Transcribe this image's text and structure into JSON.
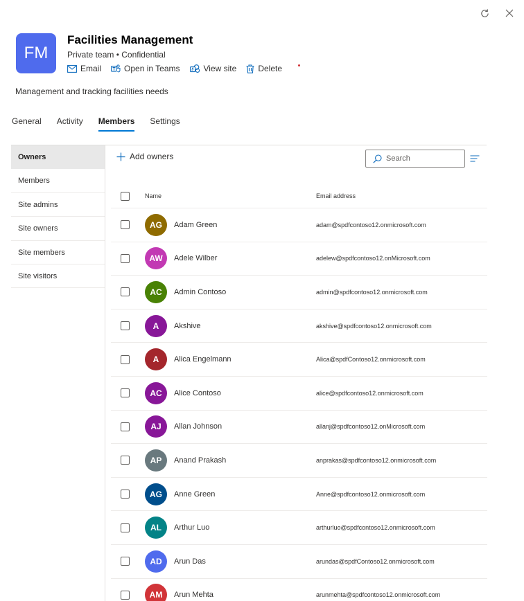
{
  "team": {
    "initials": "FM",
    "name": "Facilities Management",
    "subtitle": "Private team • Confidential",
    "logo_color": "#4f6bed",
    "description": "Management and tracking facilities needs",
    "actions": [
      {
        "label": "Email",
        "icon": "mail-icon"
      },
      {
        "label": "Open in Teams",
        "icon": "teams-icon"
      },
      {
        "label": "View site",
        "icon": "sharepoint-icon"
      },
      {
        "label": "Delete",
        "icon": "trash-icon"
      }
    ]
  },
  "window_actions": [
    {
      "icon": "refresh-icon"
    },
    {
      "icon": "close-icon"
    }
  ],
  "tabs": [
    {
      "label": "General"
    },
    {
      "label": "Activity"
    },
    {
      "label": "Members",
      "active": true
    },
    {
      "label": "Settings"
    }
  ],
  "sidebar": {
    "items": [
      {
        "label": "Owners",
        "active": true
      },
      {
        "label": "Members"
      },
      {
        "label": "Site admins"
      },
      {
        "label": "Site owners"
      },
      {
        "label": "Site members"
      },
      {
        "label": "Site visitors"
      }
    ]
  },
  "toolbar": {
    "add_label": "Add owners",
    "search_placeholder": "Search"
  },
  "table": {
    "columns": {
      "name": "Name",
      "email": "Email address"
    },
    "rows": [
      {
        "initials": "AG",
        "name": "Adam Green",
        "email": "adam@spdfcontoso12.onmicrosoft.com",
        "color": "#8f6b00"
      },
      {
        "initials": "AW",
        "name": "Adele Wilber",
        "email": "adelew@spdfcontoso12.onMicrosoft.com",
        "color": "#c239b3"
      },
      {
        "initials": "AC",
        "name": "Admin Contoso",
        "email": "admin@spdfcontoso12.onmicrosoft.com",
        "color": "#498205"
      },
      {
        "initials": "A",
        "name": "Akshive",
        "email": "akshive@spdfcontoso12.onmicrosoft.com",
        "color": "#881798"
      },
      {
        "initials": "A",
        "name": "Alica Engelmann",
        "email": "Alica@spdfContoso12.onmicrosoft.com",
        "color": "#a4262c"
      },
      {
        "initials": "AC",
        "name": "Alice Contoso",
        "email": "alice@spdfcontoso12.onmicrosoft.com",
        "color": "#881798"
      },
      {
        "initials": "AJ",
        "name": "Allan Johnson",
        "email": "allanj@spdfcontoso12.onMicrosoft.com",
        "color": "#881798"
      },
      {
        "initials": "AP",
        "name": "Anand Prakash",
        "email": "anprakas@spdfcontoso12.onmicrosoft.com",
        "color": "#69797e"
      },
      {
        "initials": "AG",
        "name": "Anne Green",
        "email": "Anne@spdfcontoso12.onmicrosoft.com",
        "color": "#004e8c"
      },
      {
        "initials": "AL",
        "name": "Arthur Luo",
        "email": "arthurluo@spdfcontoso12.onmicrosoft.com",
        "color": "#038387"
      },
      {
        "initials": "AD",
        "name": "Arun Das",
        "email": "arundas@spdfContoso12.onmicrosoft.com",
        "color": "#4f6bed"
      },
      {
        "initials": "AM",
        "name": "Arun Mehta",
        "email": "arunmehta@spdfcontoso12.onmicrosoft.com",
        "color": "#d13438"
      }
    ]
  }
}
